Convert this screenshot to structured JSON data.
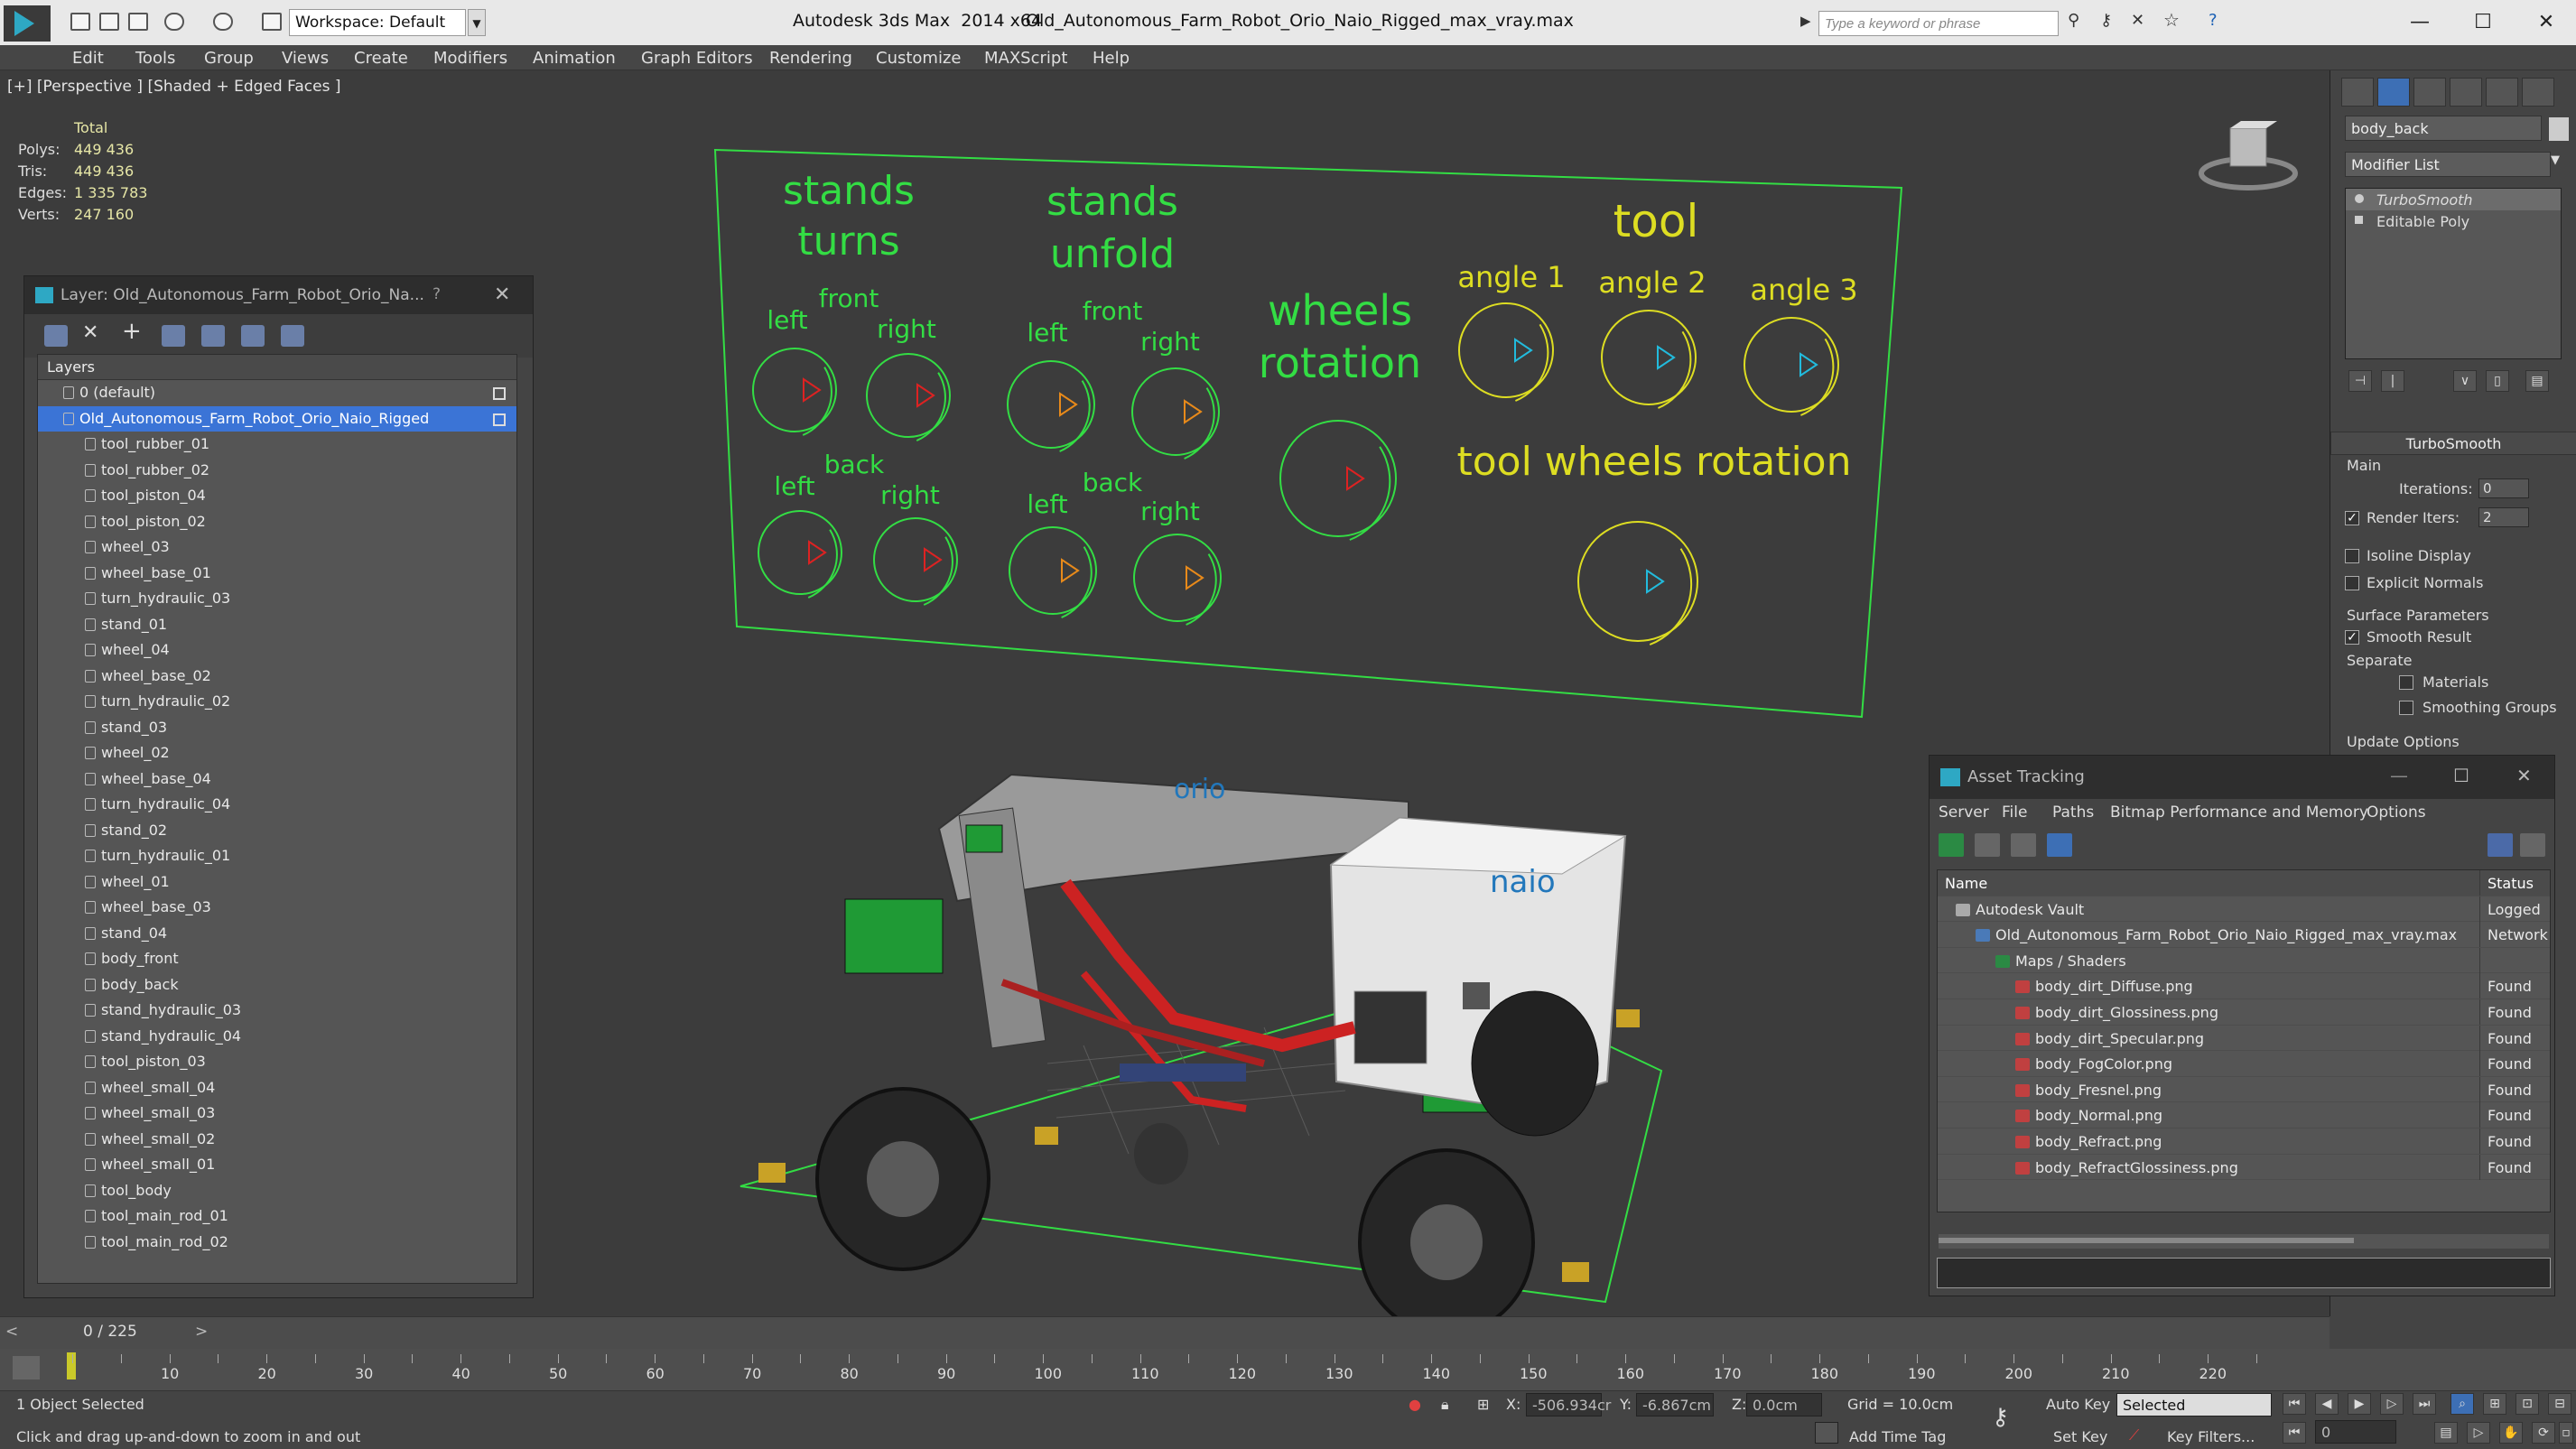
{
  "titlebar": {
    "workspace": "Workspace: Default",
    "app_title": "Autodesk 3ds Max  2014 x64",
    "file_title": "Old_Autonomous_Farm_Robot_Orio_Naio_Rigged_max_vray.max",
    "search_placeholder": "Type a keyword or phrase"
  },
  "menu": [
    "Edit",
    "Tools",
    "Group",
    "Views",
    "Create",
    "Modifiers",
    "Animation",
    "Graph Editors",
    "Rendering",
    "Customize",
    "MAXScript",
    "Help"
  ],
  "viewport": {
    "label": "[+] [Perspective ] [Shaded + Edged Faces ]",
    "stats_header": "Total",
    "stats": [
      {
        "k": "Polys:",
        "v": "449 436"
      },
      {
        "k": "Tris:",
        "v": "449 436"
      },
      {
        "k": "Edges:",
        "v": "1 335 783"
      },
      {
        "k": "Verts:",
        "v": "247 160"
      }
    ],
    "rig_labels": {
      "stands_turns_1": "stands",
      "stands_turns_2": "turns",
      "stands_unfold_1": "stands",
      "stands_unfold_2": "unfold",
      "front": "front",
      "back": "back",
      "left": "left",
      "right": "right",
      "wheels_rotation_1": "wheels",
      "wheels_rotation_2": "rotation",
      "tool": "tool",
      "angle1": "angle 1",
      "angle2": "angle 2",
      "angle3": "angle 3",
      "tool_wheels_rotation": "tool wheels rotation"
    }
  },
  "layer_panel": {
    "title": "Layer: Old_Autonomous_Farm_Robot_Orio_Na...",
    "help": "?",
    "header": "Layers",
    "layers": [
      {
        "name": "0 (default)",
        "level": 0
      },
      {
        "name": "Old_Autonomous_Farm_Robot_Orio_Naio_Rigged",
        "level": 0,
        "selected": true
      },
      {
        "name": "tool_rubber_01",
        "level": 1
      },
      {
        "name": "tool_rubber_02",
        "level": 1
      },
      {
        "name": "tool_piston_04",
        "level": 1
      },
      {
        "name": "tool_piston_02",
        "level": 1
      },
      {
        "name": "wheel_03",
        "level": 1
      },
      {
        "name": "wheel_base_01",
        "level": 1
      },
      {
        "name": "turn_hydraulic_03",
        "level": 1
      },
      {
        "name": "stand_01",
        "level": 1
      },
      {
        "name": "wheel_04",
        "level": 1
      },
      {
        "name": "wheel_base_02",
        "level": 1
      },
      {
        "name": "turn_hydraulic_02",
        "level": 1
      },
      {
        "name": "stand_03",
        "level": 1
      },
      {
        "name": "wheel_02",
        "level": 1
      },
      {
        "name": "wheel_base_04",
        "level": 1
      },
      {
        "name": "turn_hydraulic_04",
        "level": 1
      },
      {
        "name": "stand_02",
        "level": 1
      },
      {
        "name": "turn_hydraulic_01",
        "level": 1
      },
      {
        "name": "wheel_01",
        "level": 1
      },
      {
        "name": "wheel_base_03",
        "level": 1
      },
      {
        "name": "stand_04",
        "level": 1
      },
      {
        "name": "body_front",
        "level": 1
      },
      {
        "name": "body_back",
        "level": 1
      },
      {
        "name": "stand_hydraulic_03",
        "level": 1
      },
      {
        "name": "stand_hydraulic_04",
        "level": 1
      },
      {
        "name": "tool_piston_03",
        "level": 1
      },
      {
        "name": "wheel_small_04",
        "level": 1
      },
      {
        "name": "wheel_small_03",
        "level": 1
      },
      {
        "name": "wheel_small_02",
        "level": 1
      },
      {
        "name": "wheel_small_01",
        "level": 1
      },
      {
        "name": "tool_body",
        "level": 1
      },
      {
        "name": "tool_main_rod_01",
        "level": 1
      },
      {
        "name": "tool_main_rod_02",
        "level": 1
      }
    ]
  },
  "command_panel": {
    "object_name": "body_back",
    "modifier_list": "Modifier List",
    "stack": [
      "TurboSmooth",
      "Editable Poly"
    ],
    "rollout_title": "TurboSmooth",
    "main": "Main",
    "iterations_label": "Iterations:",
    "iterations": "0",
    "render_iters_label": "Render Iters:",
    "render_iters": "2",
    "isoline": "Isoline Display",
    "explicit_normals": "Explicit Normals",
    "surface_params": "Surface Parameters",
    "smooth_result": "Smooth Result",
    "separate": "Separate",
    "materials": "Materials",
    "smoothing_groups": "Smoothing Groups",
    "update_options": "Update Options"
  },
  "asset_tracking": {
    "title": "Asset Tracking",
    "menu": [
      "Server",
      "File",
      "Paths",
      "Bitmap Performance and Memory",
      "Options"
    ],
    "columns": [
      "Name",
      "Status"
    ],
    "rows": [
      {
        "name": "Autodesk Vault",
        "status": "Logged",
        "indent": 0,
        "icon": "vault"
      },
      {
        "name": "Old_Autonomous_Farm_Robot_Orio_Naio_Rigged_max_vray.max",
        "status": "Network",
        "indent": 1,
        "icon": "file"
      },
      {
        "name": "Maps / Shaders",
        "status": "",
        "indent": 2,
        "icon": "folder"
      },
      {
        "name": "body_dirt_Diffuse.png",
        "status": "Found",
        "indent": 3,
        "icon": "png"
      },
      {
        "name": "body_dirt_Glossiness.png",
        "status": "Found",
        "indent": 3,
        "icon": "png"
      },
      {
        "name": "body_dirt_Specular.png",
        "status": "Found",
        "indent": 3,
        "icon": "png"
      },
      {
        "name": "body_FogColor.png",
        "status": "Found",
        "indent": 3,
        "icon": "png"
      },
      {
        "name": "body_Fresnel.png",
        "status": "Found",
        "indent": 3,
        "icon": "png"
      },
      {
        "name": "body_Normal.png",
        "status": "Found",
        "indent": 3,
        "icon": "png"
      },
      {
        "name": "body_Refract.png",
        "status": "Found",
        "indent": 3,
        "icon": "png"
      },
      {
        "name": "body_RefractGlossiness.png",
        "status": "Found",
        "indent": 3,
        "icon": "png"
      }
    ]
  },
  "timeline": {
    "frame": "0 / 225",
    "ticks": [
      "10",
      "20",
      "30",
      "40",
      "50",
      "60",
      "70",
      "80",
      "90",
      "100",
      "110",
      "120",
      "130",
      "140",
      "150",
      "160",
      "170",
      "180",
      "190",
      "200",
      "210",
      "220"
    ]
  },
  "statusbar": {
    "selected": "1 Object Selected",
    "hint": "Click and drag up-and-down to zoom in and out",
    "x_label": "X:",
    "x": "-506.934cr",
    "y_label": "Y:",
    "y": "-6.867cm",
    "z_label": "Z:",
    "z": "0.0cm",
    "grid": "Grid = 10.0cm",
    "auto_key": "Auto Key",
    "selected_dropdown": "Selected",
    "set_key": "Set Key",
    "key_filters": "Key Filters...",
    "add_time_tag": "Add Time Tag",
    "frame_value": "0"
  },
  "colors": {
    "wire_green": "#33dd44",
    "wire_yellow": "#dddd22",
    "arrow_red": "#dd2222",
    "arrow_orange": "#e88a1a",
    "arrow_cyan": "#22bbdd",
    "select_blue": "#3b74d6"
  }
}
